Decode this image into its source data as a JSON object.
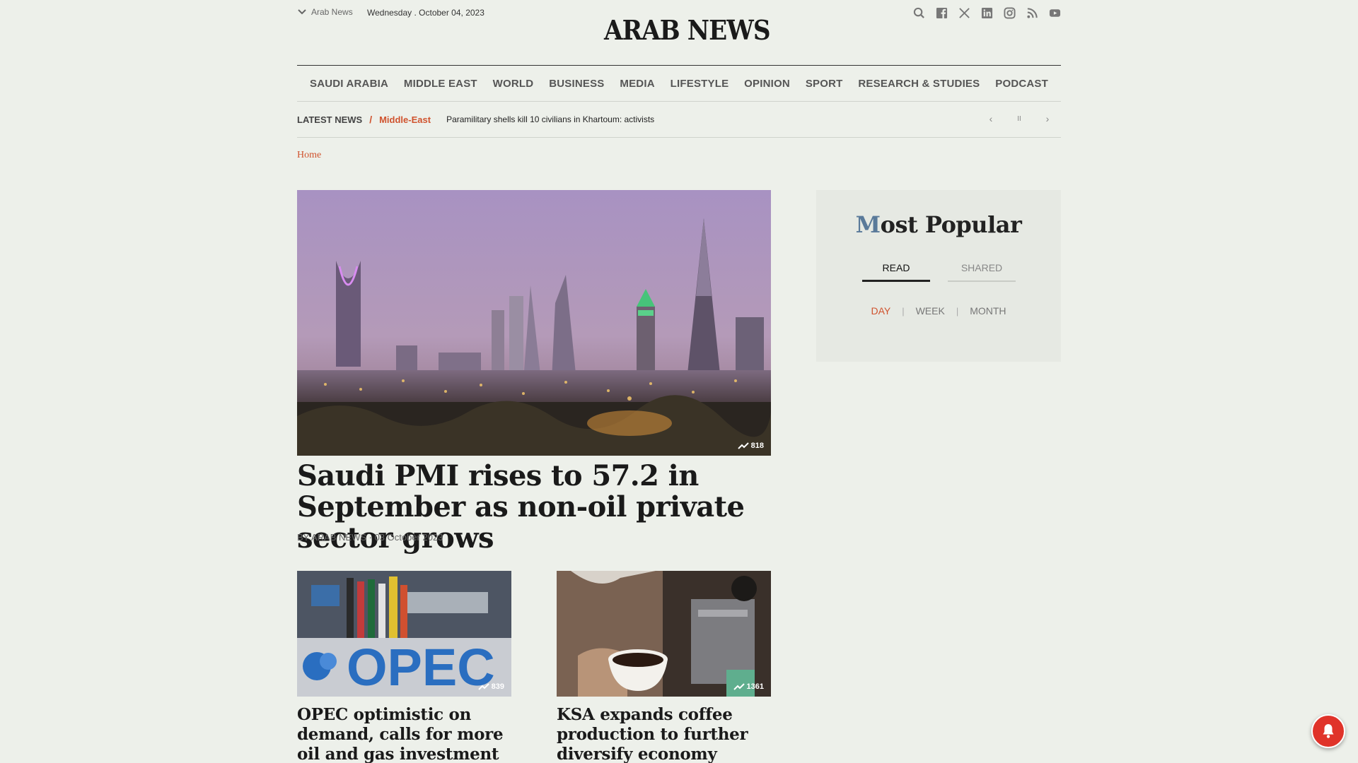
{
  "header": {
    "edition_label": "Arab News",
    "date": "Wednesday .  October 04, 2023",
    "logo": "ARAB NEWS",
    "social_icons": [
      "search-icon",
      "facebook-icon",
      "x-icon",
      "linkedin-icon",
      "instagram-icon",
      "rss-icon",
      "youtube-icon"
    ]
  },
  "nav": {
    "items": [
      "SAUDI ARABIA",
      "MIDDLE EAST",
      "WORLD",
      "BUSINESS",
      "MEDIA",
      "LIFESTYLE",
      "OPINION",
      "SPORT",
      "RESEARCH & STUDIES",
      "PODCAST"
    ]
  },
  "ticker": {
    "label": "LATEST NEWS",
    "separator": "/",
    "category": "Middle-East",
    "headline": "Paramilitary shells kill 10 civilians in Khartoum: activists",
    "prev": "‹",
    "pause": "II",
    "next": "›"
  },
  "breadcrumb": {
    "home": "Home"
  },
  "hero": {
    "views": "818",
    "title": "Saudi PMI rises to 57.2 in September as non-oil private sector grows",
    "byline": "BY ARAB NEWS · 03 October 2023"
  },
  "cards": [
    {
      "views": "839",
      "title": "OPEC optimistic on demand, calls for more oil and gas investment",
      "image_text": "OPEC"
    },
    {
      "views": "1361",
      "title": "KSA expands coffee production to further diversify economy"
    }
  ],
  "popular": {
    "title_first": "M",
    "title_rest": "ost Popular",
    "tabs": [
      "READ",
      "SHARED"
    ],
    "periods": [
      "DAY",
      "WEEK",
      "MONTH"
    ]
  },
  "colors": {
    "accent": "#d0532e",
    "background": "#edf0ea",
    "notification": "#e0332a"
  }
}
